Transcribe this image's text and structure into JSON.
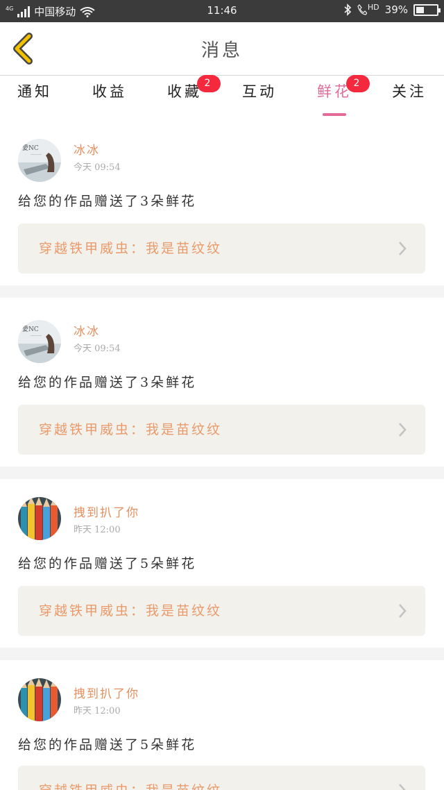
{
  "status_bar": {
    "network": "4G",
    "carrier": "中国移动",
    "time": "11:46",
    "hd": "HD",
    "battery": "39%",
    "battery_level": 0.39
  },
  "header": {
    "title": "消息"
  },
  "tabs": [
    {
      "label": "通知",
      "badge": ""
    },
    {
      "label": "收益",
      "badge": ""
    },
    {
      "label": "收藏",
      "badge": "2"
    },
    {
      "label": "互动",
      "badge": ""
    },
    {
      "label": "鲜花",
      "badge": "2",
      "active": true
    },
    {
      "label": "关注",
      "badge": ""
    }
  ],
  "messages": [
    {
      "avatar": "landscape-avatar",
      "name": "冰冰",
      "time": "今天 09:54",
      "text": "给您的作品赠送了3朵鲜花",
      "work": "穿越铁甲威虫：我是苗纹纹"
    },
    {
      "avatar": "landscape-avatar",
      "name": "冰冰",
      "time": "今天 09:54",
      "text": "给您的作品赠送了3朵鲜花",
      "work": "穿越铁甲威虫：我是苗纹纹"
    },
    {
      "avatar": "pencils-avatar",
      "name": "拽到扒了你",
      "time": "昨天 12:00",
      "text": "给您的作品赠送了5朵鲜花",
      "work": "穿越铁甲威虫：我是苗纹纹"
    },
    {
      "avatar": "pencils-avatar",
      "name": "拽到扒了你",
      "time": "昨天 12:00",
      "text": "给您的作品赠送了5朵鲜花",
      "work": "穿越铁甲威虫：我是苗纹纹"
    }
  ],
  "colors": {
    "accent": "#e46a97",
    "name": "#e49060",
    "badge": "#f5293d",
    "back_arrow": "#f2c200"
  },
  "icons": [
    "signal-icon",
    "wifi-icon",
    "bluetooth-icon",
    "call-hd-icon",
    "battery-icon",
    "back-arrow-icon",
    "chevron-right-icon"
  ]
}
